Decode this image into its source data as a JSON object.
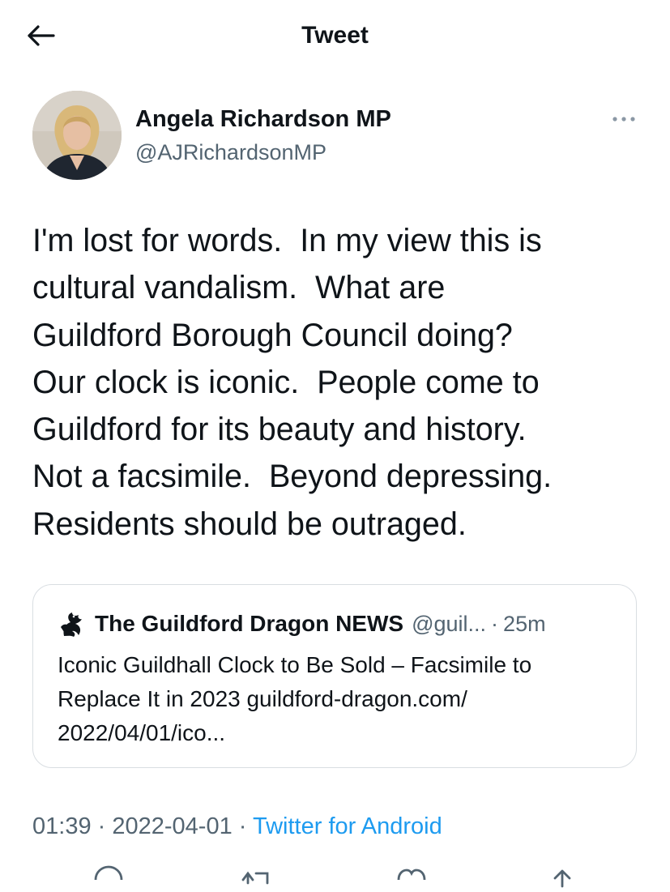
{
  "header": {
    "title": "Tweet",
    "back_icon": "arrow-left-icon"
  },
  "author": {
    "display_name": "Angela Richardson MP",
    "handle": "@AJRichardsonMP",
    "avatar_icon": "profile-photo",
    "more_icon": "ellipsis-icon"
  },
  "tweet": {
    "text": "I'm lost for words.  In my view this is\ncultural vandalism.  What are\nGuildford Borough Council doing?\nOur clock is iconic.  People come to\nGuildford for its beauty and history.\nNot a facsimile.  Beyond depressing.\nResidents should be outraged."
  },
  "quote": {
    "name": "The Guildford Dragon NEWS",
    "handle": "@guil...",
    "separator": "·",
    "time": "25m",
    "text": "Iconic Guildhall Clock to Be Sold – Facsimile to\nReplace It in 2023 guildford-dragon.com/\n2022/04/01/ico...",
    "avatar_icon": "dragon-logo-icon"
  },
  "meta": {
    "time": "01:39",
    "separator": "·",
    "date": "2022-04-01",
    "source": "Twitter for Android"
  },
  "actions": {
    "icons": [
      "reply-icon",
      "retweet-icon",
      "like-icon",
      "share-icon"
    ]
  },
  "colors": {
    "text": "#0f1419",
    "secondary": "#536471",
    "accent": "#1d9bf0",
    "border": "#d9dee2"
  }
}
